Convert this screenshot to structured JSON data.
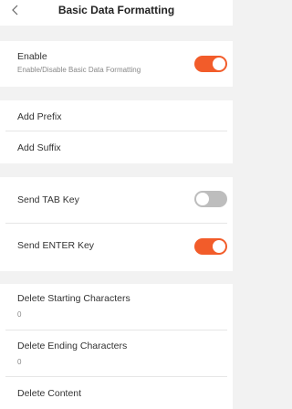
{
  "header": {
    "title": "Basic Data Formatting",
    "back_icon": "chevron-left-icon"
  },
  "enable": {
    "label": "Enable",
    "description": "Enable/Disable Basic Data Formatting",
    "toggle_on": true
  },
  "affix": {
    "prefix_label": "Add Prefix",
    "suffix_label": "Add Suffix"
  },
  "keys": {
    "tab_label": "Send TAB Key",
    "tab_on": false,
    "enter_label": "Send ENTER Key",
    "enter_on": true
  },
  "delete": {
    "starting_label": "Delete Starting Characters",
    "starting_value": "0",
    "ending_label": "Delete Ending Characters",
    "ending_value": "0",
    "content_label": "Delete Content"
  },
  "colors": {
    "accent": "#f25c2a",
    "toggle_off": "#bdbdbd",
    "background": "#f2f2f2"
  }
}
